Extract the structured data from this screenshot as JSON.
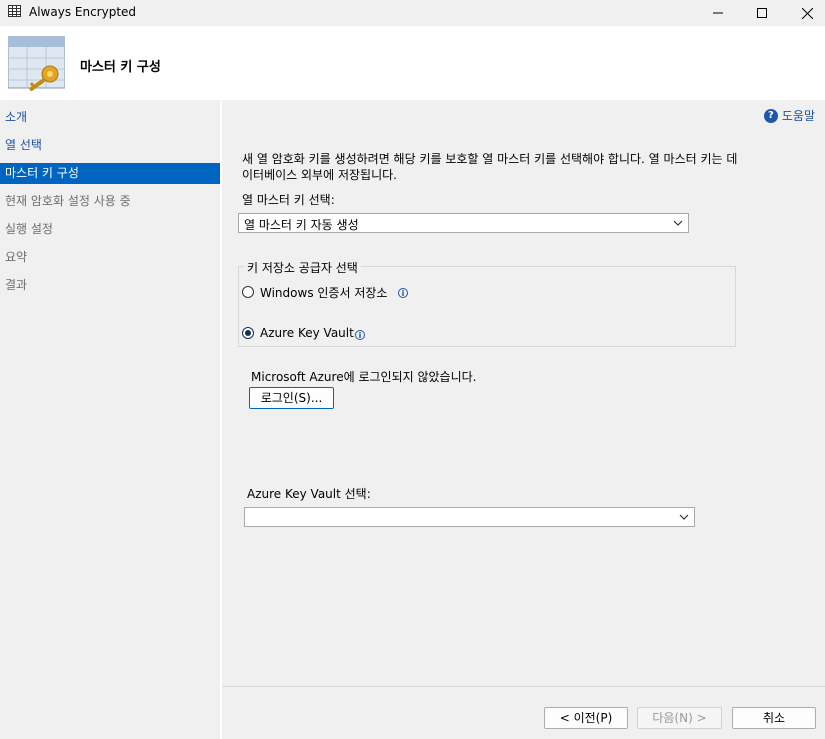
{
  "window": {
    "title": "Always Encrypted"
  },
  "header": {
    "title": "마스터 키 구성"
  },
  "sidebar": {
    "items": [
      {
        "label": "소개",
        "state": "link"
      },
      {
        "label": "열 선택",
        "state": "link"
      },
      {
        "label": "마스터 키 구성",
        "state": "active"
      },
      {
        "label": "현재 암호화 설정 사용 중",
        "state": "disabled"
      },
      {
        "label": "실행 설정",
        "state": "disabled"
      },
      {
        "label": "요약",
        "state": "disabled"
      },
      {
        "label": "결과",
        "state": "disabled"
      }
    ]
  },
  "main": {
    "help_label": "도움말",
    "description": "새 열 암호화 키를 생성하려면 해당 키를 보호할 열 마스터 키를 선택해야 합니다. 열 마스터 키는 데이터베이스 외부에 저장됩니다.",
    "cmk_label": "열 마스터 키 선택:",
    "cmk_value": "열 마스터 키 자동 생성",
    "provider_group_title": "키 저장소 공급자 선택",
    "provider_options": [
      {
        "label": "Windows 인증서 저장소",
        "selected": false
      },
      {
        "label": "Azure Key Vault",
        "selected": true
      }
    ],
    "azure_status": "Microsoft Azure에 로그인되지 않았습니다.",
    "login_button": "로그인(S)...",
    "vault_label": "Azure Key Vault 선택:",
    "vault_value": ""
  },
  "footer": {
    "prev_button": "< 이전(P)",
    "next_button": "다음(N) >",
    "cancel_button": "취소"
  },
  "colors": {
    "accent": "#0065c1",
    "link": "#1f4e9b"
  }
}
